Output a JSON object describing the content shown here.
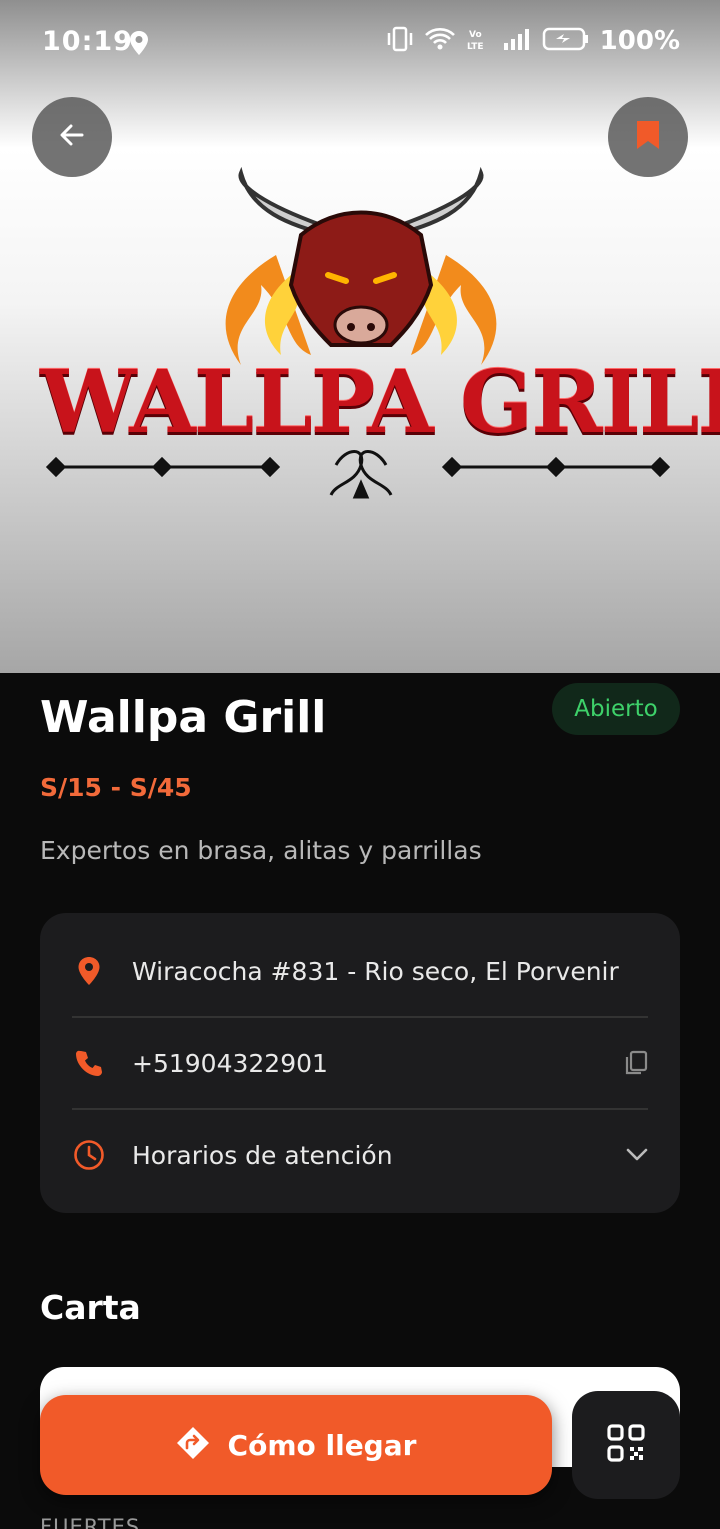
{
  "status_bar": {
    "time": "10:19",
    "battery": "100%",
    "icons": [
      "location-icon",
      "vibrate-icon",
      "wifi-icon",
      "volte-icon",
      "signal-icon",
      "battery-icon"
    ]
  },
  "hero": {
    "logo_text": "WALLPA GRILL",
    "back_icon": "arrow-left-icon",
    "bookmark_icon": "bookmark-icon"
  },
  "restaurant": {
    "name": "Wallpa Grill",
    "status": "Abierto",
    "price_range": "S/15 - S/45",
    "description": "Expertos en brasa, alitas y parrillas"
  },
  "info": {
    "address": "Wiracocha #831 - Rio seco, El Porvenir",
    "phone": "+51904322901",
    "hours_label": "Horarios de atención"
  },
  "menu_section": {
    "title": "Carta",
    "next_heading_peek": "FUERTES"
  },
  "actions": {
    "directions_label": "Cómo llegar"
  },
  "colors": {
    "accent": "#f15a29",
    "open_green": "#3ed16a",
    "background": "#0b0b0b",
    "card": "#1c1c1e"
  }
}
